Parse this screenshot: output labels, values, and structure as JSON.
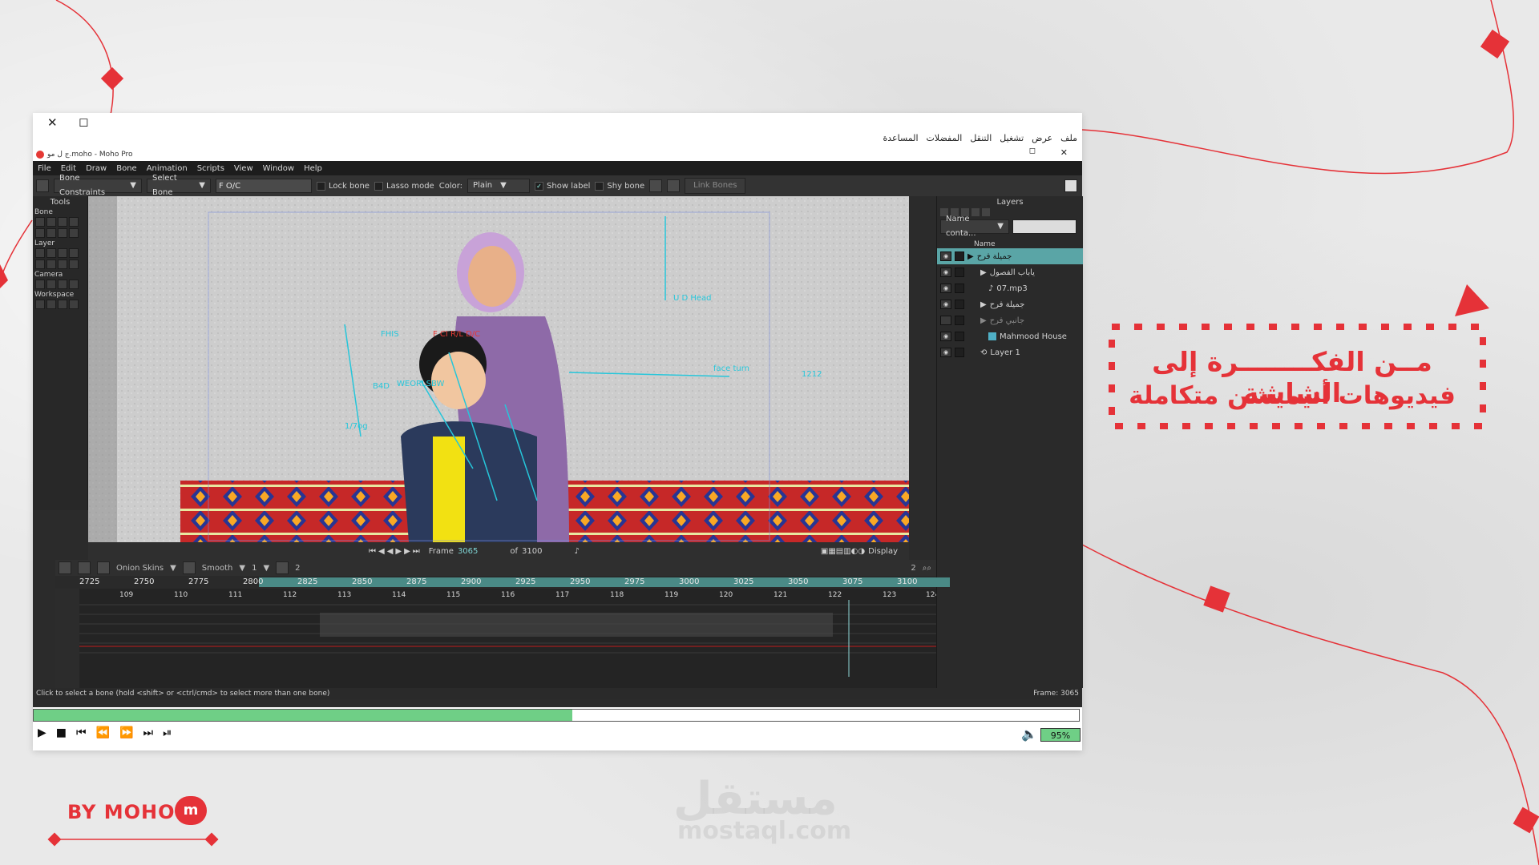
{
  "window": {
    "close_glyph": "✕",
    "restore_glyph": "◻",
    "arabic_menu": [
      "ملف",
      "عرض",
      "تشغيل",
      "التنقل",
      "المفضلات",
      "المساعدة"
    ],
    "inner_restore": "◻",
    "inner_close": "✕",
    "app_title": "ج ل مو.moho - Moho Pro"
  },
  "menubar": [
    "File",
    "Edit",
    "Draw",
    "Bone",
    "Animation",
    "Scripts",
    "View",
    "Window",
    "Help"
  ],
  "tool_options": {
    "bone_constraints": "Bone Constraints",
    "select_bone": "Select Bone",
    "bone_name": "F O/C",
    "lock_bone": "Lock bone",
    "lasso_mode": "Lasso mode",
    "color_label": "Color:",
    "color_value": "Plain",
    "show_label": "Show label",
    "shy_bone": "Shy bone",
    "link_bones": "Link Bones"
  },
  "tools": {
    "title": "Tools",
    "sections": [
      "Bone",
      "Layer",
      "Camera",
      "Workspace"
    ]
  },
  "canvas": {
    "bone_labels": [
      "U D Head",
      "FHIS",
      "F CI R/L D/C",
      "face turn",
      "1212",
      "B4D",
      "WEORLSBW",
      "1/7og"
    ]
  },
  "frame_bar": {
    "frame_label": "Frame",
    "frame_value": "3065",
    "of_label": "of",
    "of_value": "3100",
    "display_label": "Display"
  },
  "layers": {
    "title": "Layers",
    "filter": "Name conta...",
    "col_name": "Name",
    "items": [
      {
        "name": "جميلة فرح"
      },
      {
        "name": "ياباب الفصول"
      },
      {
        "name": "07.mp3"
      },
      {
        "name": "جميلة فرح"
      },
      {
        "name": "جانبي فرح"
      },
      {
        "name": "Mahmood House"
      },
      {
        "name": "Layer 1"
      }
    ]
  },
  "timeline": {
    "onion_skins": "Onion Skins",
    "interp": "Smooth",
    "interp_val": "1",
    "step": "2",
    "zoom_val": "2",
    "ruler_frames": [
      "2725",
      "2750",
      "2775",
      "2800",
      "2825",
      "2850",
      "2875",
      "2900",
      "2925",
      "2950",
      "2975",
      "3000",
      "3025",
      "3050",
      "3075",
      "3100"
    ],
    "seconds": [
      "109",
      "110",
      "111",
      "112",
      "113",
      "114",
      "115",
      "116",
      "117",
      "118",
      "119",
      "120",
      "121",
      "122",
      "123",
      "124"
    ]
  },
  "status": {
    "hint": "Click to select a bone (hold <shift> or <ctrl/cmd> to select more than one bone)",
    "frame": "Frame: 3065"
  },
  "player": {
    "progress": 0.515,
    "zoom": "95%",
    "accent": "#6fcf86"
  },
  "tagline": {
    "line1": "مــن الفكــــــــرة إلى الشاشة",
    "line2": "فيديوهات أنيميشن متكاملة"
  },
  "byline": "BY MOHO",
  "logo_letter": "m",
  "watermark": {
    "ar": "مستقل",
    "en": "mostaql.com"
  },
  "colors": {
    "brand_red": "#e53238",
    "bone_cyan": "#26c6da",
    "selection": "#5aa5a6"
  }
}
